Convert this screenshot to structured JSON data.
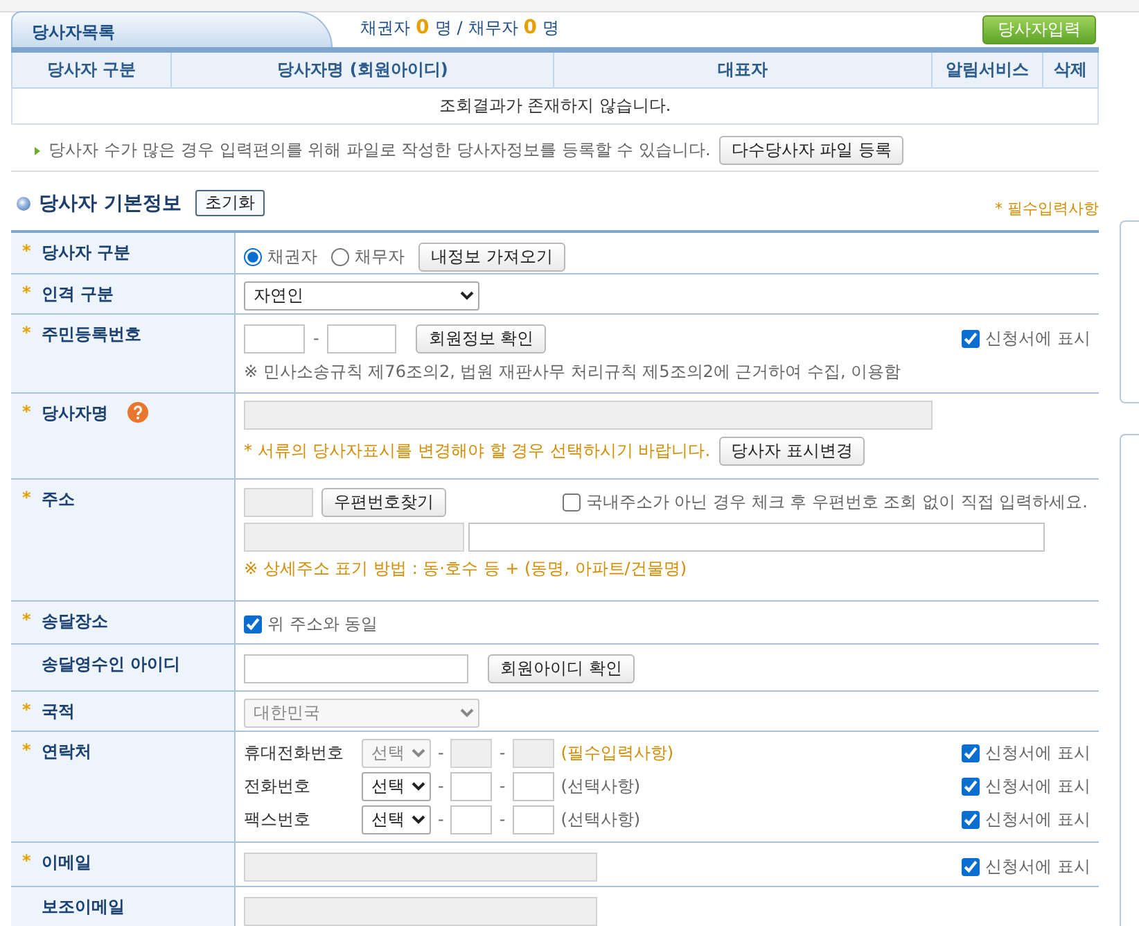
{
  "party_list": {
    "tab_label": "당사자목록",
    "summary": {
      "creditor_label": "채권자",
      "creditor_count": "0",
      "creditor_unit": "명",
      "separator": "/",
      "debtor_label": "채무자",
      "debtor_count": "0",
      "debtor_unit": "명"
    },
    "add_button": "당사자입력",
    "columns": [
      "당사자 구분",
      "당사자명 (회원아이디)",
      "대표자",
      "알림서비스",
      "삭제"
    ],
    "empty_message": "조회결과가 존재하지 않습니다.",
    "bulk_note": "당사자 수가 많은 경우 입력편의를 위해 파일로 작성한 당사자정보를 등록할 수 있습니다.",
    "bulk_button": "다수당사자 파일 등록"
  },
  "basic_info": {
    "title": "당사자 기본정보",
    "reset_button": "초기화",
    "required_note": "* 필수입력사항",
    "rows": [
      {
        "kind": "radio",
        "mark": "*",
        "label": "당사자 구분",
        "options": [
          {
            "label": "채권자",
            "selected": true
          },
          {
            "label": "채무자",
            "selected": false
          }
        ],
        "button": "내정보 가져오기"
      },
      {
        "kind": "select",
        "mark": "*",
        "label": "인격 구분",
        "value": "자연인",
        "disabled": false
      },
      {
        "kind": "id_number",
        "mark": "*",
        "label": "주민등록번호",
        "separator": "-",
        "button": "회원정보 확인",
        "checkbox": {
          "label": "신청서에 표시",
          "checked": true
        },
        "note": "※ 민사소송규칙 제76조의2, 법원 재판사무 처리규칙 제5조의2에 근거하여 수집, 이용함"
      },
      {
        "kind": "name",
        "mark": "*",
        "label": "당사자명",
        "disabled": true,
        "note": "* 서류의 당사자표시를 변경해야 할 경우 선택하시기 바랍니다.",
        "button": "당사자 표시변경"
      },
      {
        "kind": "address",
        "mark": "*",
        "label": "주소",
        "disabled": true,
        "button": "우편번호찾기",
        "checkbox": {
          "label": "국내주소가 아닌 경우 체크 후 우편번호 조회 없이 직접 입력하세요.",
          "checked": false
        },
        "note": "※ 상세주소 표기 방법 : 동·호수 등 + (동명, 아파트/건물명)"
      },
      {
        "kind": "checkbox",
        "mark": "*",
        "label": "송달장소",
        "checkbox": {
          "label": "위 주소와 동일",
          "checked": true
        }
      },
      {
        "kind": "text_button",
        "label": "송달영수인 아이디",
        "button": "회원아이디 확인"
      },
      {
        "kind": "select",
        "mark": "*",
        "label": "국적",
        "value": "대한민국",
        "disabled": true
      },
      {
        "kind": "contact",
        "mark": "*",
        "label": "연락처",
        "lines": [
          {
            "label": "휴대전화번호",
            "select": "선택",
            "disabled": true,
            "separators": [
              "-",
              "-"
            ],
            "note": "(필수입력사항)",
            "required": true,
            "checkbox": {
              "label": "신청서에 표시",
              "checked": true
            }
          },
          {
            "label": "전화번호",
            "select": "선택",
            "disabled": false,
            "separators": [
              "-",
              "-"
            ],
            "note": "(선택사항)",
            "required": false,
            "checkbox": {
              "label": "신청서에 표시",
              "checked": true
            }
          },
          {
            "label": "팩스번호",
            "select": "선택",
            "disabled": false,
            "separators": [
              "-",
              "-"
            ],
            "note": "(선택사항)",
            "required": false,
            "checkbox": {
              "label": "신청서에 표시",
              "checked": true
            }
          }
        ]
      },
      {
        "kind": "email",
        "mark": "*",
        "label": "이메일",
        "disabled": true,
        "checkbox": {
          "label": "신청서에 표시",
          "checked": true
        }
      },
      {
        "kind": "email",
        "label": "보조이메일",
        "disabled": true
      }
    ]
  }
}
